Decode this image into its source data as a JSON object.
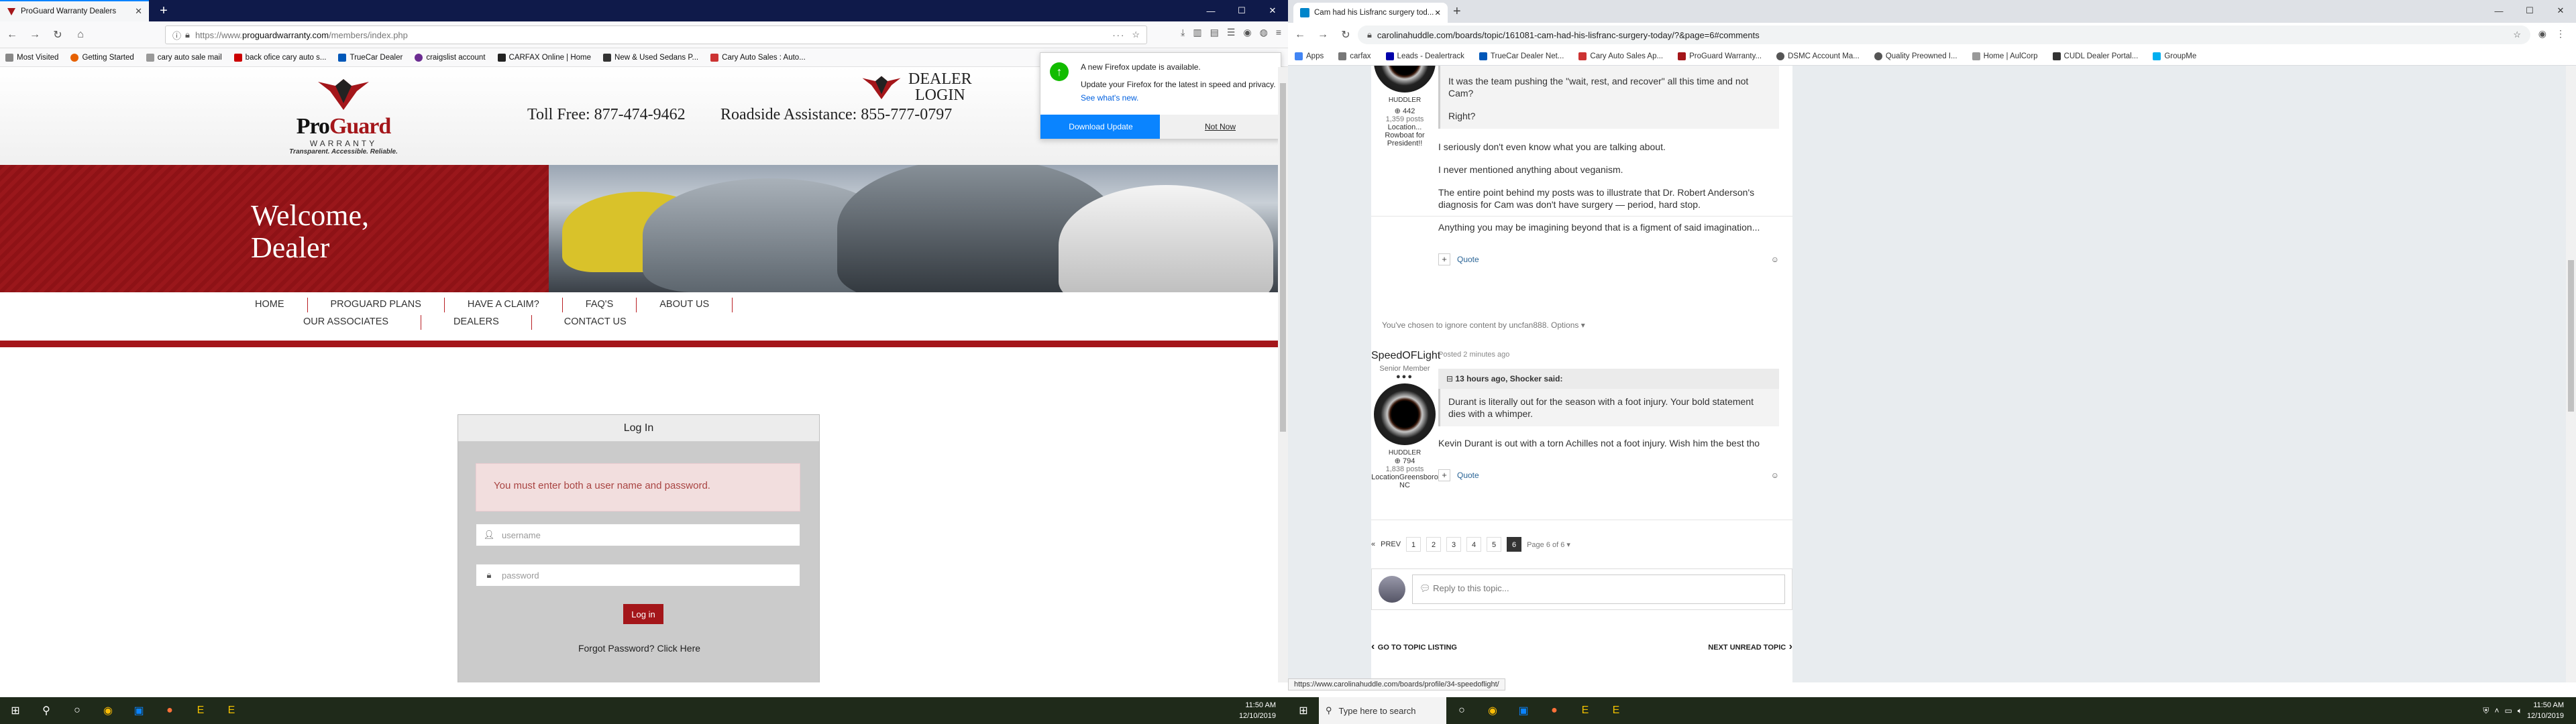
{
  "left": {
    "tab_title": "ProGuard Warranty Dealers",
    "url": "https://www.proguardwarranty.com/members/index.php",
    "url_prefix": "https://www.",
    "url_domain": "proguardwarranty.com",
    "url_path": "/members/index.php",
    "bookmarks": [
      "Most Visited",
      "Getting Started",
      "cary auto sale mail",
      "back ofice cary auto s...",
      "TrueCar Dealer",
      "craigslist account",
      "CARFAX Online | Home",
      "New & Used Sedans P...",
      "Cary Auto Sales : Auto..."
    ],
    "site": {
      "logo_pro": "Pro",
      "logo_guard": "Guard",
      "logo_warranty": "WARRANTY",
      "logo_tagline": "Transparent. Accessible. Reliable.",
      "toll_free": "Toll Free: 877-474-9462",
      "roadside": "Roadside Assistance: 855-777-0797",
      "dealer_login_1": "DEALER",
      "dealer_login_2": "LOGIN",
      "welcome_1": "Welcome,",
      "welcome_2": "Dealer",
      "nav_row1": [
        "HOME",
        "PROGUARD PLANS",
        "HAVE A CLAIM?",
        "FAQ'S",
        "ABOUT US"
      ],
      "nav_row2": [
        "OUR ASSOCIATES",
        "DEALERS",
        "CONTACT US"
      ],
      "login_title": "Log In",
      "error": "You must enter both a user name and password.",
      "username_placeholder": "username",
      "password_placeholder": "password",
      "login_button": "Log in",
      "forgot": "Forgot Password? Click Here"
    },
    "update_popup": {
      "title": "A new Firefox update is available.",
      "body": "Update your Firefox for the latest in speed and privacy.",
      "link": "See what's new.",
      "download": "Download Update",
      "notnow": "Not Now"
    }
  },
  "right": {
    "tab_title": "Cam had his Lisfranc surgery tod...",
    "url": "carolinahuddle.com/boards/topic/161081-cam-had-his-lisfranc-surgery-today/?&page=6#comments",
    "bookmarks": [
      "Apps",
      "carfax",
      "Leads - Dealertrack",
      "TrueCar Dealer Net...",
      "Cary Auto Sales Ap...",
      "ProGuard Warranty...",
      "DSMC Account Ma...",
      "Quality Preowned I...",
      "Home | AulCorp",
      "CUDL Dealer Portal...",
      "GroupMe"
    ],
    "post1": {
      "badge": "HUDDLER",
      "rep": "442",
      "posts": "1,359 posts",
      "location": "Location...",
      "location2": "Rowboat for President!!",
      "quote_line1": "It was the team pushing the \"wait, rest, and recover\" all this time and not Cam?",
      "quote_line2": "Right?",
      "p1": "I seriously don't even know what you are talking about.",
      "p2": "I never mentioned anything about veganism.",
      "p3": "The entire point behind my posts was to illustrate that Dr. Robert Anderson's diagnosis for Cam was don't have surgery — period, hard stop.",
      "p4": "Anything you may be imagining beyond that is a figment of said imagination...",
      "quote_btn": "Quote"
    },
    "ignored": "You've chosen to ignore content by uncfan888.",
    "ignored_options": "Options ▾",
    "post2": {
      "author": "SpeedOFLight",
      "title": "Senior Member",
      "badge": "HUDDLER",
      "rep": "794",
      "posts": "1,838 posts",
      "location": "LocationGreensboro NC",
      "time": "Posted 2 minutes ago",
      "quote_head": "13 hours ago, Shocker said:",
      "quote": "Durant is literally out for the season with a foot injury.  Your bold statement dies with a whimper.",
      "body": "Kevin Durant is out with a torn Achilles not a foot injury. Wish him the best tho",
      "quote_btn": "Quote"
    },
    "pager": {
      "prev": "PREV",
      "pages": [
        "1",
        "2",
        "3",
        "4",
        "5",
        "6"
      ],
      "current": "6",
      "label": "Page 6 of 6 ▾"
    },
    "reply_placeholder": "Reply to this topic...",
    "go_listing": "GO TO TOPIC LISTING",
    "next_unread": "NEXT UNREAD TOPIC",
    "status_url": "https://www.carolinahuddle.com/boards/profile/34-speedoflight/"
  },
  "taskbar": {
    "time": "11:50 AM",
    "date": "12/10/2019",
    "search": "Type here to search"
  },
  "colors": {
    "brand_red": "#a4161a",
    "firefox_blue": "#0a84ff"
  }
}
